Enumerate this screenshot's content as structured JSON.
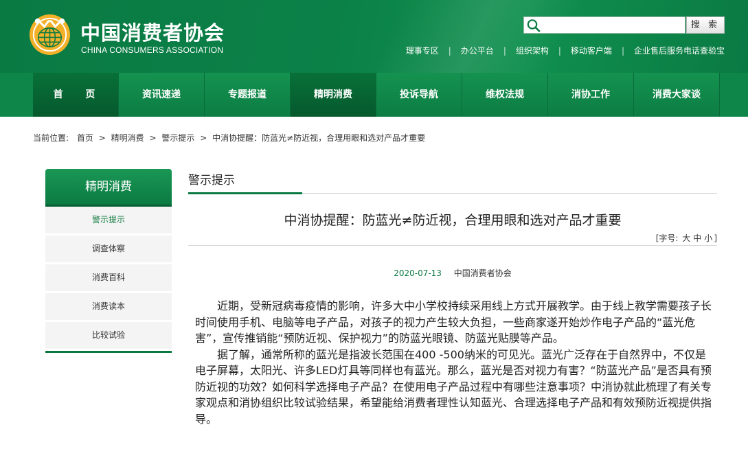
{
  "header": {
    "org_name_cn": "中国消费者协会",
    "org_name_en": "CHINA CONSUMERS ASSOCIATION",
    "search": {
      "placeholder": "",
      "button_label": "搜 索"
    },
    "top_links": [
      "理事专区",
      "办公平台",
      "组织架构",
      "移动客户端",
      "企业售后服务电话查验宝"
    ]
  },
  "nav": {
    "items": [
      {
        "label": "首 页",
        "active": true
      },
      {
        "label": "资讯速递",
        "active": false
      },
      {
        "label": "专题报道",
        "active": false
      },
      {
        "label": "精明消费",
        "active": true
      },
      {
        "label": "投诉导航",
        "active": false
      },
      {
        "label": "维权法规",
        "active": false
      },
      {
        "label": "消协工作",
        "active": false
      },
      {
        "label": "消费大家谈",
        "active": false
      }
    ]
  },
  "breadcrumb": {
    "prefix": "当前位置:",
    "items": [
      "首页",
      "精明消费",
      "警示提示"
    ],
    "current": "中消协提醒：防蓝光≠防近视，合理用眼和选对产品才重要"
  },
  "sidebar": {
    "title": "精明消费",
    "items": [
      {
        "label": "警示提示",
        "active": true
      },
      {
        "label": "调查体察",
        "active": false
      },
      {
        "label": "消费百科",
        "active": false
      },
      {
        "label": "消费读本",
        "active": false
      },
      {
        "label": "比较试验",
        "active": false
      }
    ]
  },
  "main": {
    "section_title": "警示提示",
    "article": {
      "title": "中消协提醒：防蓝光≠防近视，合理用眼和选对产品才重要",
      "font_size_label": "[字号:",
      "font_size_options": [
        "大",
        "中",
        "小"
      ],
      "font_size_close": "]",
      "date": "2020-07-13",
      "source": "中国消费者协会",
      "paragraphs": [
        "近期，受新冠病毒疫情的影响，许多大中小学校持续采用线上方式开展教学。由于线上教学需要孩子长时间使用手机、电脑等电子产品，对孩子的视力产生较大负担，一些商家遂开始炒作电子产品的“蓝光危害”，宣传推销能“预防近视、保护视力”的防蓝光眼镜、防蓝光贴膜等产品。",
        "据了解，通常所称的蓝光是指波长范围在400 -500纳米的可见光。蓝光广泛存在于自然界中，不仅是电子屏幕，太阳光、许多LED灯具等同样也有蓝光。那么，蓝光是否对视力有害？“防蓝光产品”是否具有预防近视的功效？如何科学选择电子产品？在使用电子产品过程中有哪些注意事项？中消协就此梳理了有关专家观点和消协组织比较试验结果，希望能给消费者理性认知蓝光、合理选择电子产品和有效预防近视提供指导。"
      ]
    }
  },
  "colors": {
    "brand_green": "#0b7a42",
    "nav_green": "#0e8549",
    "logo_gold": "#f3b12a"
  },
  "icons": [
    "cca-logo-icon",
    "search-icon"
  ]
}
